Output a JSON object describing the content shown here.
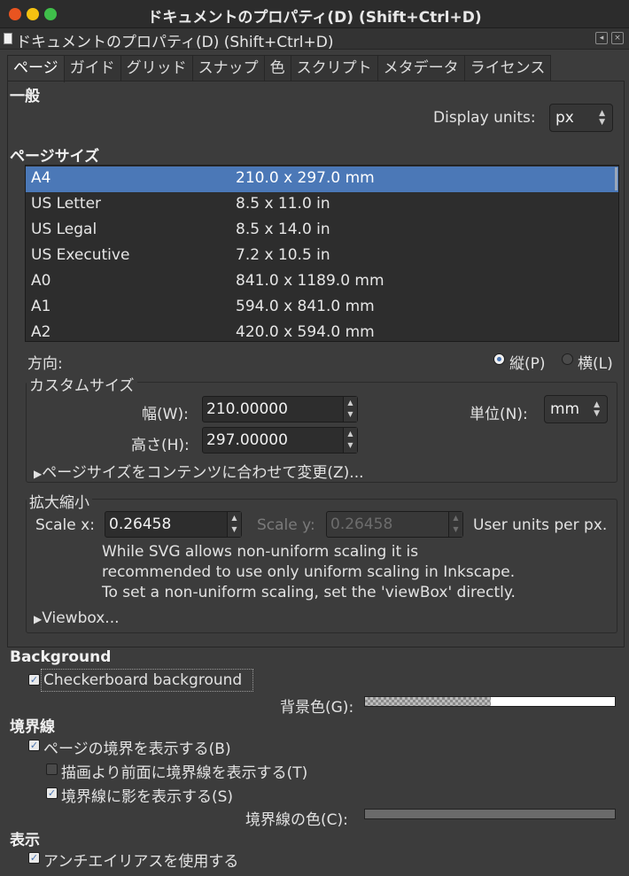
{
  "window": {
    "title": "ドキュメントのプロパティ(D) (Shift+Ctrl+D)"
  },
  "dock": {
    "title": "ドキュメントのプロパティ(D) (Shift+Ctrl+D)"
  },
  "tabs": [
    "ページ",
    "ガイド",
    "グリッド",
    "スナップ",
    "色",
    "スクリプト",
    "メタデータ",
    "ライセンス"
  ],
  "general": {
    "heading": "一般",
    "display_units_label": "Display units:",
    "display_units_value": "px"
  },
  "page_size": {
    "heading": "ページサイズ",
    "rows": [
      {
        "name": "A4",
        "size": "210.0 x 297.0 mm",
        "selected": true
      },
      {
        "name": "US Letter",
        "size": "8.5 x 11.0 in"
      },
      {
        "name": "US Legal",
        "size": "8.5 x 14.0 in"
      },
      {
        "name": "US Executive",
        "size": "7.2 x 10.5 in"
      },
      {
        "name": "A0",
        "size": "841.0 x 1189.0 mm"
      },
      {
        "name": "A1",
        "size": "594.0 x 841.0 mm"
      },
      {
        "name": "A2",
        "size": "420.0 x 594.0 mm"
      }
    ]
  },
  "orientation": {
    "label": "方向:",
    "portrait": "縦(P)",
    "landscape": "横(L)",
    "selected": "portrait"
  },
  "custom_size": {
    "title": "カスタムサイズ",
    "width_label": "幅(W):",
    "width_value": "210.00000",
    "height_label": "高さ(H):",
    "height_value": "297.00000",
    "units_label": "単位(N):",
    "units_value": "mm",
    "resize_expander": "ページサイズをコンテンツに合わせて変更(Z)..."
  },
  "scale": {
    "title": "拡大縮小",
    "scale_x_label": "Scale x:",
    "scale_x_value": "0.26458",
    "scale_y_label": "Scale y:",
    "scale_y_value": "0.26458",
    "units_text": "User units per px.",
    "note_line1": "While SVG allows non-uniform scaling it is",
    "note_line2": "recommended to use only uniform scaling in Inkscape.",
    "note_line3": "To set a non-uniform scaling, set the 'viewBox' directly.",
    "viewbox_expander": "Viewbox..."
  },
  "background": {
    "heading": "Background",
    "checkerboard_label": "Checkerboard background",
    "checkerboard_checked": true,
    "color_label": "背景色(G):"
  },
  "border": {
    "heading": "境界線",
    "show_border_label": "ページの境界を表示する(B)",
    "show_border_checked": true,
    "on_top_label": "描画より前面に境界線を表示する(T)",
    "on_top_checked": false,
    "shadow_label": "境界線に影を表示する(S)",
    "shadow_checked": true,
    "color_label": "境界線の色(C):"
  },
  "display": {
    "heading": "表示",
    "antialias_label": "アンチエイリアスを使用する",
    "antialias_checked": true
  }
}
